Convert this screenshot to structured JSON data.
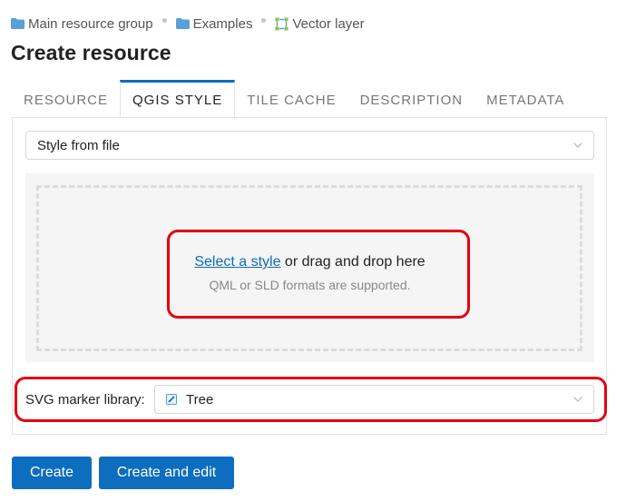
{
  "breadcrumb": {
    "items": [
      "Main resource group",
      "Examples",
      "Vector layer"
    ]
  },
  "page": {
    "title": "Create resource"
  },
  "tabs": [
    {
      "label": "RESOURCE",
      "active": false
    },
    {
      "label": "QGIS STYLE",
      "active": true
    },
    {
      "label": "TILE CACHE",
      "active": false
    },
    {
      "label": "DESCRIPTION",
      "active": false
    },
    {
      "label": "METADATA",
      "active": false
    }
  ],
  "style_select": {
    "value": "Style from file"
  },
  "drop_zone": {
    "link_text": "Select a style",
    "rest_text": " or drag and drop here",
    "hint": "QML or SLD formats are supported."
  },
  "marker_library": {
    "label": "SVG marker library:",
    "value": "Tree"
  },
  "actions": {
    "create": "Create",
    "create_and_edit": "Create and edit"
  },
  "colors": {
    "accent": "#0d6dbf",
    "highlight": "#e3000f",
    "folder": "#5aa0d8"
  }
}
